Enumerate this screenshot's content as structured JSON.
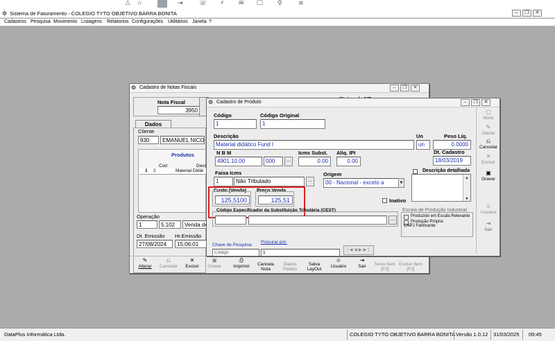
{
  "topbar": {
    "icons": [
      "⚠",
      "☆",
      "▣",
      "⇥",
      "☏",
      "⚡",
      "✉",
      "🖵",
      "⚲",
      "≡"
    ]
  },
  "app": {
    "title": "Sistema de Faturamento - COLEGIO TYTO OBJETIVO BARRA BONITA",
    "menu": [
      "Cadastros",
      "Pesquisa",
      "Movimento",
      "Listagens",
      "Relatorios",
      "Configurações",
      "Utilitários",
      "Janela",
      "?"
    ]
  },
  "notas": {
    "title": "Cadastro de Notas Fiscais",
    "nota_fiscal_label": "Nota Fiscal",
    "nota_fiscal_value": "3950",
    "status_label": "Status da NF-e",
    "tab_dados": "Dados",
    "cliente_label": "Cliente",
    "cliente_code": "930",
    "cliente_name": "EMANUEL NICO",
    "produtos_title": "Produtos",
    "col_cod": "Cod",
    "col_desc": "Desc",
    "row_num": "1",
    "row_cod": "2",
    "row_desc": "Material Didát",
    "operacao_label": "Operação",
    "operacao_num": "1",
    "operacao_code": "5.102",
    "operacao_desc": "Venda de",
    "emissao_label": "Dt. Emissão",
    "emissao_value": "27/08/2024",
    "hr_emissao_label": "Hr.Emissão",
    "hr_emissao_value": "15:06:01",
    "toolbar": [
      {
        "icon": "✎",
        "label": "Alterar"
      },
      {
        "icon": "⎌",
        "label": "Cancelar"
      },
      {
        "icon": "✕",
        "label": "Excluir"
      },
      {
        "icon": "▣",
        "label": "Gravar"
      },
      {
        "icon": "⎙",
        "label": "Imprimir"
      },
      {
        "icon": "",
        "label": "Cancela Nota"
      },
      {
        "icon": "",
        "label": "Dados Pedido"
      },
      {
        "icon": "",
        "label": "Salva LayOut"
      },
      {
        "icon": "☺",
        "label": "Usuário"
      },
      {
        "icon": "⇥",
        "label": "Sair"
      },
      {
        "icon": "",
        "label": "Novo Item [F2]"
      },
      {
        "icon": "",
        "label": "Excluir Item [F3]"
      }
    ]
  },
  "produto": {
    "title": "Cadastro de Produto",
    "codigo_label": "Código",
    "codigo_value": "1",
    "codigo_original_label": "Código Original",
    "codigo_original_value": "1",
    "descricao_label": "Descrição",
    "descricao_value": "Material didático Fund I",
    "un_label": "Un",
    "un_value": "un",
    "peso_label": "Peso Líq.",
    "peso_value": "0.0000",
    "nbm_label": "N B M",
    "nbm_value": "4901.10.00",
    "nbm_ext": "000",
    "icms_subst_label": "Icms Subst.",
    "icms_subst_value": "0.00",
    "aliq_ipi_label": "Aliq. IPI",
    "aliq_ipi_value": "0.00",
    "dt_cadastro_label": "Dt. Cadastro",
    "dt_cadastro_value": "18/03/2019",
    "faixa_icms_label": "Faixa Icms",
    "faixa_icms_code": "1",
    "faixa_icms_value": "Não Tributado",
    "origem_label": "Origem",
    "origem_value": "00 - Nacional - exceto a",
    "descricao_detalhada_label": "Descrição detalhada",
    "custo_label": "Custo (Venda)",
    "custo_value": "125,5100",
    "preco_label": "Preço Venda",
    "preco_value": "125,51",
    "inativo_label": "Inativo",
    "cest_label": "Código Especificador da Substituição Tributária (CEST)",
    "escala_label": "Escala de Produção Industrial",
    "escala_opt1": "Produzido em Escala Relevante",
    "escala_opt2": "Produção Própria",
    "cnpj_label": "CNPJ Fabricante",
    "chave_label": "Chave de Pesquisa:",
    "chave_value": "Código",
    "procurar_label": "Procurar por:",
    "procurar_value": "1",
    "side_buttons": [
      {
        "icon": "▢",
        "label": "Novo"
      },
      {
        "icon": "✎",
        "label": "Alterar"
      },
      {
        "icon": "⎌",
        "label": "Cancelar"
      },
      {
        "icon": "✕",
        "label": "Excluir"
      },
      {
        "icon": "▣",
        "label": "Gravar"
      },
      {
        "icon": "☺",
        "label": "Usuário"
      },
      {
        "icon": "⇥",
        "label": "Sair"
      }
    ]
  },
  "status_bar": {
    "company": "DataPlus Informática Ltda.",
    "school": "COLEGIO TYTO OBJETIVO BARRA BONITA",
    "version": "Versão 1.0.12",
    "date": "31/03/2025",
    "time": "09:45"
  },
  "colors": {
    "highlight_box": "#e02020",
    "field_text": "#1a2fb0",
    "desktop": "#ababab"
  }
}
